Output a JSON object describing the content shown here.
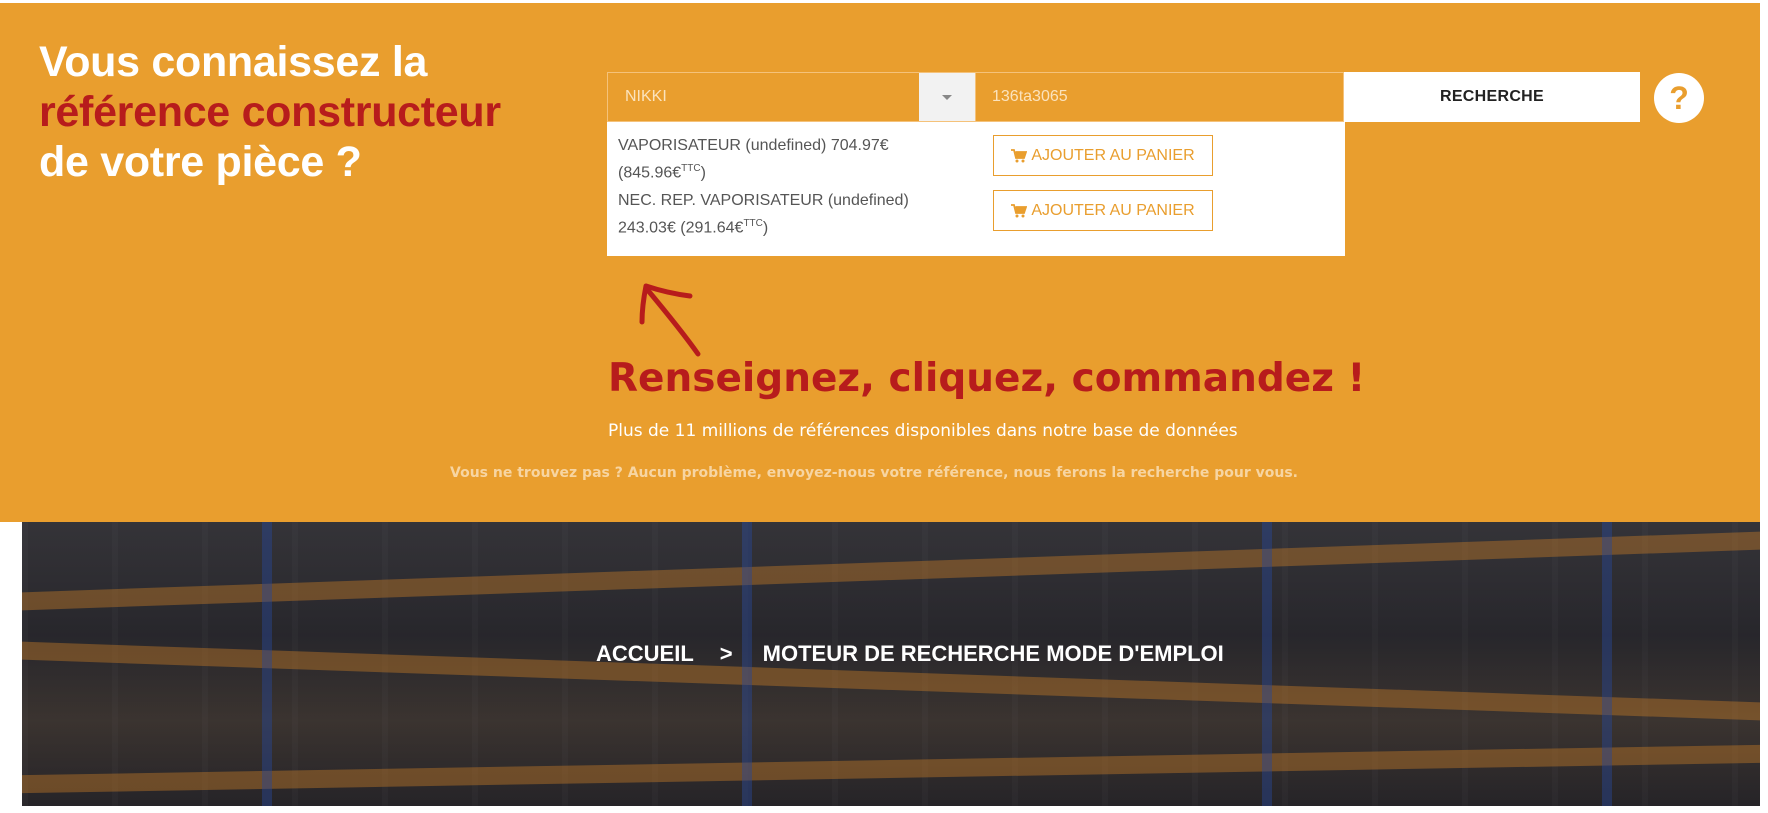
{
  "headline": {
    "line1": "Vous connaissez la",
    "line2": "référence constructeur",
    "line3": "de votre pièce ?"
  },
  "search": {
    "brand_selected": "NIKKI",
    "reference_value": "136ta3065",
    "button_label": "RECHERCHE",
    "help_label": "?"
  },
  "results": [
    {
      "line1": "VAPORISATEUR (undefined) 704.97€",
      "line2_prefix": "(845.96€",
      "line2_sup": "TTC",
      "line2_suffix": ")",
      "button_label": "AJOUTER AU PANIER"
    },
    {
      "line1": "NEC. REP. VAPORISATEUR (undefined)",
      "line2_prefix": "243.03€ (291.64€",
      "line2_sup": "TTC",
      "line2_suffix": ")",
      "button_label": "AJOUTER AU PANIER"
    }
  ],
  "tagline": "Renseignez, cliquez, commandez !",
  "subline": "Plus de 11 millions de références disponibles dans notre base de données",
  "notfound": "Vous ne trouvez pas ? Aucun problème, envoyez-nous votre référence, nous ferons la recherche pour vous.",
  "breadcrumb": {
    "home": "ACCUEIL",
    "separator": ">",
    "current": "MOTEUR DE RECHERCHE MODE D'EMPLOI"
  },
  "colors": {
    "panel_orange": "#e99e2e",
    "accent_red": "#b71c1c",
    "white": "#ffffff"
  },
  "icons": [
    "chevron-down-icon",
    "cart-icon",
    "arrow-annotation-icon"
  ]
}
